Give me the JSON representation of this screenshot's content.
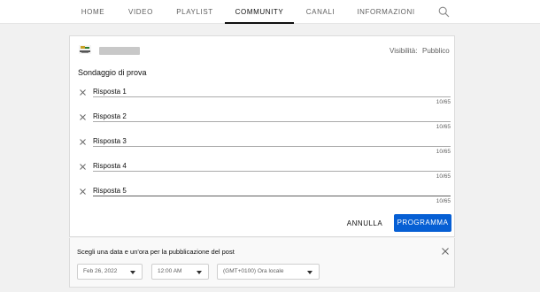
{
  "nav": {
    "tabs": [
      "HOME",
      "VIDEO",
      "PLAYLIST",
      "COMMUNITY",
      "CANALI",
      "INFORMAZIONI"
    ],
    "active": "COMMUNITY"
  },
  "post": {
    "visibility_label": "Visibilità:",
    "visibility_value": "Pubblico",
    "poll_title": "Sondaggio di prova",
    "answers": [
      {
        "label": "Risposta 1",
        "count": "10/65"
      },
      {
        "label": "Risposta 2",
        "count": "10/65"
      },
      {
        "label": "Risposta 3",
        "count": "10/65"
      },
      {
        "label": "Risposta 4",
        "count": "10/65"
      },
      {
        "label": "Risposta 5",
        "count": "10/65"
      }
    ],
    "cancel_label": "ANNULLA",
    "schedule_label": "PROGRAMMA",
    "schedule_color": "#065fd4"
  },
  "schedule": {
    "title": "Scegli una data e un'ora per la pubblicazione del post",
    "date": "Feb 26, 2022",
    "time": "12:00 AM",
    "timezone": "(GMT+0100) Ora locale"
  }
}
